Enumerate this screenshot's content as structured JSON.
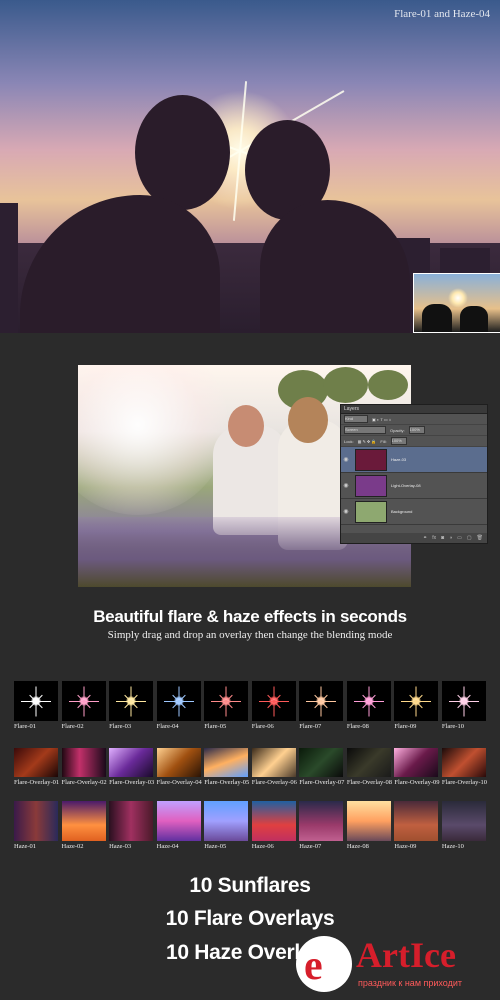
{
  "hero": {
    "label": "Flare-01 and Haze-04"
  },
  "layers_panel": {
    "title": "Layers",
    "kind_label": "Kind",
    "blend_mode": "Screen",
    "opacity_label": "Opacity:",
    "opacity_value": "100%",
    "lock_label": "Lock:",
    "fill_label": "Fill:",
    "fill_value": "100%",
    "rows": [
      {
        "name": "Haze-03",
        "active": true,
        "thumb": "#6a1a3a"
      },
      {
        "name": "Light-Overlay-08",
        "active": false,
        "thumb": "#7a3b8a"
      },
      {
        "name": "Background",
        "active": false,
        "thumb": "#8ea870"
      }
    ]
  },
  "headline": "Beautiful flare & haze effects in seconds",
  "subline": "Simply drag and drop an overlay then change the blending mode",
  "flares": [
    {
      "name": "Flare-01",
      "color": "#ffffff"
    },
    {
      "name": "Flare-02",
      "color": "#ff9ec8"
    },
    {
      "name": "Flare-03",
      "color": "#ffe8a0"
    },
    {
      "name": "Flare-04",
      "color": "#9ec8ff"
    },
    {
      "name": "Flare-05",
      "color": "#ff8a8a"
    },
    {
      "name": "Flare-06",
      "color": "#ff5a5a"
    },
    {
      "name": "Flare-07",
      "color": "#ffc8a0"
    },
    {
      "name": "Flare-08",
      "color": "#ff9ed8"
    },
    {
      "name": "Flare-09",
      "color": "#ffd98a"
    },
    {
      "name": "Flare-10",
      "color": "#ffd0e8"
    }
  ],
  "overlays": [
    {
      "name": "Flare-Overlay-01",
      "bg": "linear-gradient(135deg,#3a0a0a,#a33a1a 50%,#1a0606)"
    },
    {
      "name": "Flare-Overlay-02",
      "bg": "linear-gradient(90deg,#200812,#c2306a 40%,#1a0a1a)"
    },
    {
      "name": "Flare-Overlay-03",
      "bg": "linear-gradient(135deg,#e0b0ff,#6a2a9a 50%,#1a0a2a)"
    },
    {
      "name": "Flare-Overlay-04",
      "bg": "linear-gradient(135deg,#ffd090,#a05010 50%,#2a1406)"
    },
    {
      "name": "Flare-Overlay-05",
      "bg": "linear-gradient(160deg,#2a2a4a,#ffb060 50%,#60a0ff)"
    },
    {
      "name": "Flare-Overlay-06",
      "bg": "linear-gradient(135deg,#3a2a1a,#ffd090 50%,#4a3a2a)"
    },
    {
      "name": "Flare-Overlay-07",
      "bg": "linear-gradient(135deg,#0a1a0a,#2a4a2a 50%,#0a0a0a)"
    },
    {
      "name": "Flare-Overlay-08",
      "bg": "linear-gradient(135deg,#0a0a0a,#3a3a2a 50%,#1a1a1a)"
    },
    {
      "name": "Flare-Overlay-09",
      "bg": "linear-gradient(135deg,#ffb0e0,#6a1a4a 50%,#1a0a1a)"
    },
    {
      "name": "Flare-Overlay-10",
      "bg": "linear-gradient(135deg,#1a0a0a,#c05030 50%,#2a0a0a)"
    }
  ],
  "hazes": [
    {
      "name": "Haze-01",
      "bg": "linear-gradient(90deg,#3a1a4a,#8a3a3a,#2a2a5a)"
    },
    {
      "name": "Haze-02",
      "bg": "linear-gradient(180deg,#4a1a6a,#ff9040 60%,#e06020)"
    },
    {
      "name": "Haze-03",
      "bg": "linear-gradient(90deg,#2a1020,#a03060,#4a1a2a)"
    },
    {
      "name": "Haze-04",
      "bg": "linear-gradient(180deg,#c0a0ff,#e060c0 50%,#6030a0)"
    },
    {
      "name": "Haze-05",
      "bg": "linear-gradient(180deg,#60a0ff,#a0a0ff 50%,#6a4a9a)"
    },
    {
      "name": "Haze-06",
      "bg": "linear-gradient(180deg,#2060a0,#e04040 60%,#c03060)"
    },
    {
      "name": "Haze-07",
      "bg": "linear-gradient(180deg,#2a2a4a,#9a3a6a 60%,#c06090)"
    },
    {
      "name": "Haze-08",
      "bg": "linear-gradient(180deg,#ffe0a0,#ffa060 50%,#6a4a5a)"
    },
    {
      "name": "Haze-09",
      "bg": "linear-gradient(180deg,#4a2a3a,#c06040 60%,#a05030)"
    },
    {
      "name": "Haze-10",
      "bg": "linear-gradient(180deg,#2a2a3a,#5a4a6a 60%,#3a2a3a)"
    }
  ],
  "features": [
    "10 Sunflares",
    "10 Flare Overlays",
    "10 Haze Overlays"
  ],
  "watermark": {
    "mark": "e",
    "name": "ArtIce",
    "tagline": "праздник к нам приходит"
  }
}
